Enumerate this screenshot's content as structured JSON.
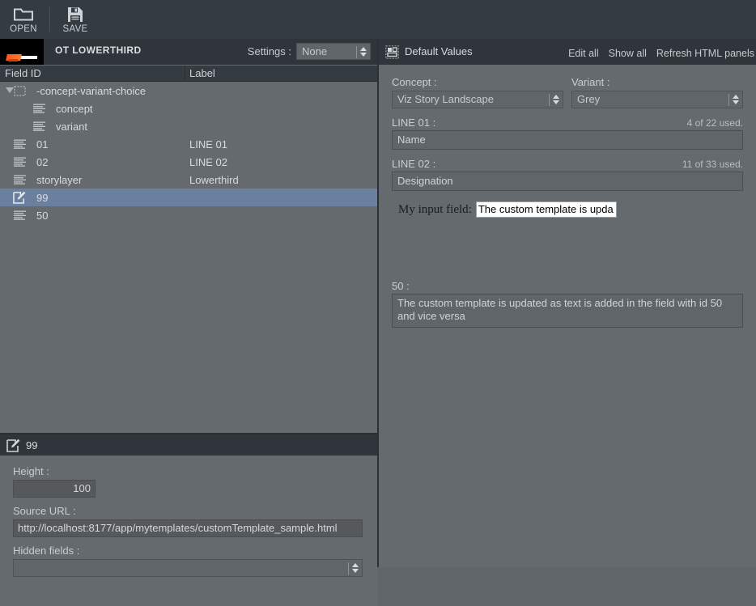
{
  "toolbar": {
    "open_label": "OPEN",
    "save_label": "SAVE"
  },
  "template_header": {
    "name": "OT LOWERTHIRD",
    "settings_label": "Settings :",
    "settings_value": "None"
  },
  "field_table": {
    "columns": [
      "Field ID",
      "Label"
    ],
    "rows": [
      {
        "id": "-concept-variant-choice",
        "label": "",
        "icon": "dashed-box-icon",
        "indent": 0,
        "expanded": true,
        "selected": false
      },
      {
        "id": "concept",
        "label": "",
        "icon": "text-lines-icon",
        "indent": 2,
        "selected": false
      },
      {
        "id": "variant",
        "label": "",
        "icon": "text-lines-icon",
        "indent": 2,
        "selected": false
      },
      {
        "id": "01",
        "label": "LINE 01",
        "icon": "text-lines-icon",
        "indent": 1,
        "selected": false
      },
      {
        "id": "02",
        "label": "LINE 02",
        "icon": "text-lines-icon",
        "indent": 1,
        "selected": false
      },
      {
        "id": "storylayer",
        "label": "Lowerthird",
        "icon": "text-lines-icon",
        "indent": 1,
        "selected": false
      },
      {
        "id": "99",
        "label": "",
        "icon": "edit-pencil-icon",
        "indent": 1,
        "selected": true
      },
      {
        "id": "50",
        "label": "",
        "icon": "text-lines-icon",
        "indent": 1,
        "selected": false
      }
    ]
  },
  "properties": {
    "title": "99",
    "height_label": "Height :",
    "height_value": "100",
    "source_url_label": "Source URL :",
    "source_url_value": "http://localhost:8177/app/mytemplates/customTemplate_sample.html",
    "hidden_fields_label": "Hidden fields :",
    "hidden_fields_value": ""
  },
  "default_values": {
    "title": "Default Values",
    "actions": [
      "Edit all",
      "Show all",
      "Refresh HTML panels"
    ],
    "concept_label": "Concept :",
    "concept_value": "Viz Story Landscape",
    "variant_label": "Variant :",
    "variant_value": "Grey",
    "line01_label": "LINE 01 :",
    "line01_counter": "4 of 22 used.",
    "line01_value": "Name",
    "line02_label": "LINE 02 :",
    "line02_counter": "11 of 33 used.",
    "line02_value": "Designation",
    "html_panel": {
      "label": "My input field:",
      "value": "The custom template is upda"
    },
    "field50_label": "50 :",
    "field50_value": "The custom template is updated as text is added in the field with id 50 and vice versa"
  },
  "colors": {
    "toolbar_bg": "#353c41",
    "panel_bg": "#646a6e",
    "header_bg": "#2f353a",
    "selection": "#6b7f9e",
    "input_bg": "#55595c",
    "accent_orange": "#ff5a17"
  }
}
